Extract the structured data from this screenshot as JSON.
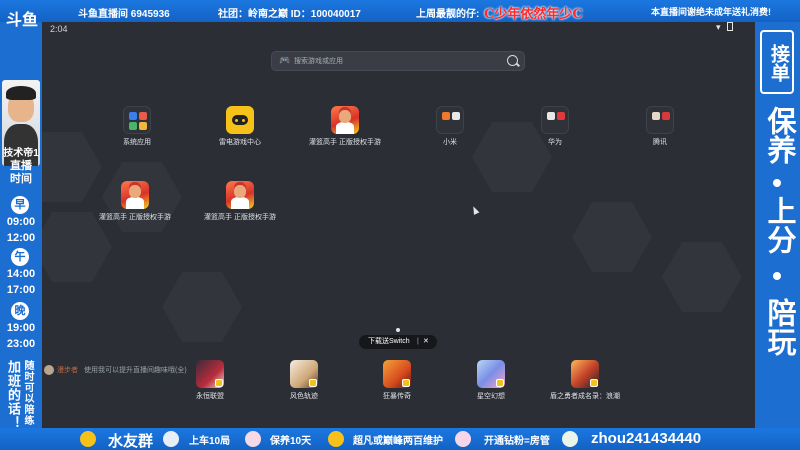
{
  "top_banner": {
    "room": "斗鱼直播间 6945936",
    "club": "社团：岭南之巅 ID：100040017",
    "best_fan_label": "上周最靓的仔:",
    "best_fan_name": "C少年依然年少C",
    "notice": "本直播间谢绝未成年送礼消费!"
  },
  "left_panel": {
    "logo": "斗鱼",
    "streamer_name": "技术帝1",
    "schedule_title": "直播时间",
    "schedule": [
      {
        "period": "早",
        "time": "09:00"
      },
      {
        "period": "",
        "time": "12:00"
      },
      {
        "period": "午",
        "time": "14:00"
      },
      {
        "period": "",
        "time": "17:00"
      },
      {
        "period": "晚",
        "time": "19:00"
      },
      {
        "period": "",
        "time": "23:00"
      }
    ],
    "join_words": "加班的话！",
    "anytime": "随时可以陪练"
  },
  "right_panel": {
    "order_tag": "接单",
    "services": [
      "保养",
      "上分",
      "陪玩"
    ]
  },
  "screen": {
    "status_time": "2:04",
    "search": {
      "placeholder": "搜索游戏或应用"
    },
    "apps": [
      {
        "label": "系统应用",
        "icon": "folder-icon"
      },
      {
        "label": "雷电游戏中心",
        "icon": "gamepad-icon"
      },
      {
        "label": "灌篮高手 正版授权手游",
        "icon": "slam-dunk-icon"
      },
      {
        "label": "小米",
        "icon": "folder-icon"
      },
      {
        "label": "华为",
        "icon": "folder-icon"
      },
      {
        "label": "腾讯",
        "icon": "folder-icon"
      },
      {
        "label": "灌篮高手 正版授权手游",
        "icon": "slam-dunk-icon"
      },
      {
        "label": "灌篮高手 正版授权手游",
        "icon": "slam-dunk-icon"
      }
    ],
    "promo": {
      "label": "下载送Switch",
      "divider": "|",
      "close": "✕"
    },
    "chat": {
      "user": "漫步者",
      "text": "使用我可以提升直播间趣味哦(全)"
    },
    "dock": [
      {
        "label": "永恒联盟"
      },
      {
        "label": "风色轨迹"
      },
      {
        "label": "狂暴传奇"
      },
      {
        "label": "星空幻想"
      },
      {
        "label": "盾之勇者成名录：浪潮"
      }
    ]
  },
  "bottom_banner": {
    "items": [
      {
        "text": "水友群"
      },
      {
        "text": "上车10局"
      },
      {
        "text": "保养10天"
      },
      {
        "text": "超凡或巅峰两百维护"
      },
      {
        "text": "开通钻粉=房管"
      },
      {
        "text": "zhou241434440"
      }
    ]
  }
}
